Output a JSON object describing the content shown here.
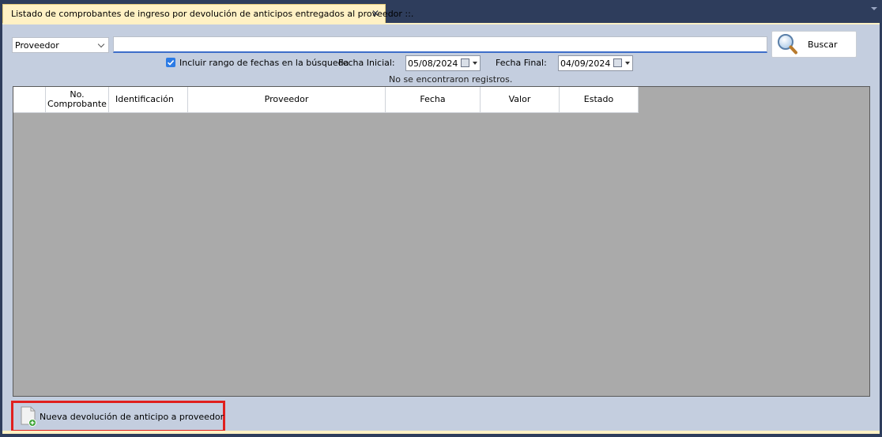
{
  "tab": {
    "title": "Listado de comprobantes de ingreso por devolución de anticipos entregados al proveedor ::.",
    "close_glyph": "✕"
  },
  "filter": {
    "field_selected": "Proveedor",
    "search_value": "",
    "search_button": "Buscar"
  },
  "date_range": {
    "checkbox_label": "Incluir rango de fechas en la búsqueda",
    "checked": true,
    "start_label": "Fecha Inicial:",
    "start_value": "05/08/2024",
    "end_label": "Fecha Final:",
    "end_value": "04/09/2024"
  },
  "status_message": "No se encontraron registros.",
  "grid": {
    "columns": [
      {
        "key": "selector",
        "label": ""
      },
      {
        "key": "no_comprobante",
        "label": "No.\nComprobante"
      },
      {
        "key": "identificacion",
        "label": "Identificación"
      },
      {
        "key": "proveedor",
        "label": "Proveedor"
      },
      {
        "key": "fecha",
        "label": "Fecha"
      },
      {
        "key": "valor",
        "label": "Valor"
      },
      {
        "key": "estado",
        "label": "Estado"
      }
    ],
    "rows": []
  },
  "actions": {
    "new_label": "Nueva devolución de anticipo a proveedor"
  },
  "colors": {
    "frame": "#2e3d5c",
    "tab_active": "#fff1c4",
    "panel": "#c4cedf",
    "grid_empty": "#aaaaaa",
    "highlight": "#e0201e",
    "accent": "#2c7be5"
  },
  "icons": {
    "tab_close": "close-icon",
    "search": "magnifier-icon",
    "checkbox": "checkmark-icon",
    "calendar": "calendar-icon",
    "new_doc": "document-add-icon"
  }
}
